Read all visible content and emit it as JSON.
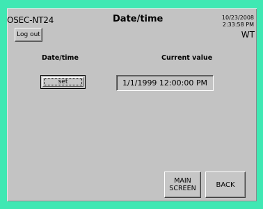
{
  "header": {
    "device": "OSEC-NT24",
    "title": "Date/time",
    "date": "10/23/2008",
    "time": "2:33:58 PM",
    "mode": "WT"
  },
  "toolbar": {
    "logout_label": "Log out"
  },
  "table": {
    "left_header": "Date/time",
    "right_header": "Current value",
    "set_label": "set",
    "current_value": "1/1/1999 12:00:00 PM"
  },
  "footer": {
    "main_line1": "MAIN",
    "main_line2": "SCREEN",
    "back_label": "BACK"
  },
  "colors": {
    "frame": "#3fe8b3",
    "panel": "#c3c3c3"
  }
}
